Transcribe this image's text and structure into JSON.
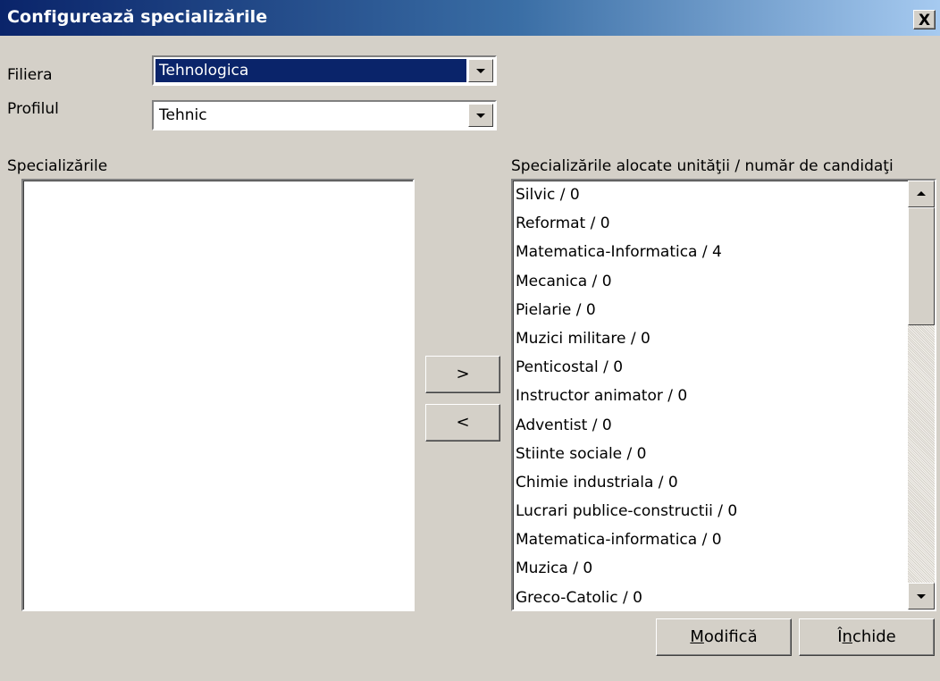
{
  "window": {
    "title": "Configurează specializările",
    "close_label": "X"
  },
  "filiera": {
    "label": "Filiera",
    "value": "Tehnologica"
  },
  "profilul": {
    "label": "Profilul",
    "value": "Tehnic"
  },
  "left_list": {
    "label": "Specializările",
    "items": []
  },
  "right_list": {
    "label": "Specializările alocate unităţii / număr de candidaţi",
    "items": [
      "Silvic / 0",
      "Reformat / 0",
      "Matematica-Informatica / 4",
      "Mecanica / 0",
      "Pielarie / 0",
      "Muzici militare / 0",
      "Penticostal / 0",
      "Instructor animator / 0",
      "Adventist / 0",
      "Stiinte sociale / 0",
      "Chimie industriala / 0",
      "Lucrari publice-constructii / 0",
      "Matematica-informatica / 0",
      "Muzica / 0",
      "Greco-Catolic / 0"
    ]
  },
  "transfer": {
    "add_label": ">",
    "remove_label": "<"
  },
  "buttons": {
    "modify_label": "Modifică",
    "modify_first": "M",
    "modify_rest": "odifică",
    "close_label": "Închide",
    "close_first": "Î",
    "close_mid": "n",
    "close_rest": "chide"
  },
  "colors": {
    "title_start": "#0a246a",
    "title_end": "#a6caf0",
    "selection": "#0a246a",
    "face": "#d4d0c8"
  }
}
